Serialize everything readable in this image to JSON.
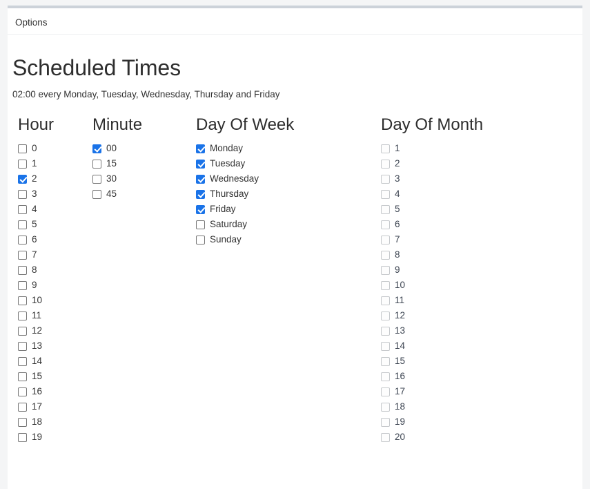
{
  "window": {
    "background_color": "#f4f5f6",
    "panel_color": "#ffffff",
    "accent_color": "#1a73e8",
    "top_border_color": "#ccd2d9"
  },
  "tabs": [
    {
      "id": "options",
      "label": "Options",
      "selected": true
    }
  ],
  "page": {
    "title": "Scheduled Times",
    "subtitle": "02:00 every Monday, Tuesday, Wednesday, Thursday and Friday"
  },
  "columns": [
    {
      "id": "hour",
      "heading": "Hour",
      "disabled": false,
      "options": [
        {
          "label": "0",
          "checked": false
        },
        {
          "label": "1",
          "checked": false
        },
        {
          "label": "2",
          "checked": true
        },
        {
          "label": "3",
          "checked": false
        },
        {
          "label": "4",
          "checked": false
        },
        {
          "label": "5",
          "checked": false
        },
        {
          "label": "6",
          "checked": false
        },
        {
          "label": "7",
          "checked": false
        },
        {
          "label": "8",
          "checked": false
        },
        {
          "label": "9",
          "checked": false
        },
        {
          "label": "10",
          "checked": false
        },
        {
          "label": "11",
          "checked": false
        },
        {
          "label": "12",
          "checked": false
        },
        {
          "label": "13",
          "checked": false
        },
        {
          "label": "14",
          "checked": false
        },
        {
          "label": "15",
          "checked": false
        },
        {
          "label": "16",
          "checked": false
        },
        {
          "label": "17",
          "checked": false
        },
        {
          "label": "18",
          "checked": false
        },
        {
          "label": "19",
          "checked": false
        }
      ]
    },
    {
      "id": "minute",
      "heading": "Minute",
      "disabled": false,
      "options": [
        {
          "label": "00",
          "checked": true
        },
        {
          "label": "15",
          "checked": false
        },
        {
          "label": "30",
          "checked": false
        },
        {
          "label": "45",
          "checked": false
        }
      ]
    },
    {
      "id": "day-of-week",
      "heading": "Day Of Week",
      "disabled": false,
      "options": [
        {
          "label": "Monday",
          "checked": true
        },
        {
          "label": "Tuesday",
          "checked": true
        },
        {
          "label": "Wednesday",
          "checked": true
        },
        {
          "label": "Thursday",
          "checked": true
        },
        {
          "label": "Friday",
          "checked": true
        },
        {
          "label": "Saturday",
          "checked": false
        },
        {
          "label": "Sunday",
          "checked": false
        }
      ]
    },
    {
      "id": "day-of-month",
      "heading": "Day Of Month",
      "disabled": true,
      "options": [
        {
          "label": "1",
          "checked": false
        },
        {
          "label": "2",
          "checked": false
        },
        {
          "label": "3",
          "checked": false
        },
        {
          "label": "4",
          "checked": false
        },
        {
          "label": "5",
          "checked": false
        },
        {
          "label": "6",
          "checked": false
        },
        {
          "label": "7",
          "checked": false
        },
        {
          "label": "8",
          "checked": false
        },
        {
          "label": "9",
          "checked": false
        },
        {
          "label": "10",
          "checked": false
        },
        {
          "label": "11",
          "checked": false
        },
        {
          "label": "12",
          "checked": false
        },
        {
          "label": "13",
          "checked": false
        },
        {
          "label": "14",
          "checked": false
        },
        {
          "label": "15",
          "checked": false
        },
        {
          "label": "16",
          "checked": false
        },
        {
          "label": "17",
          "checked": false
        },
        {
          "label": "18",
          "checked": false
        },
        {
          "label": "19",
          "checked": false
        },
        {
          "label": "20",
          "checked": false
        }
      ]
    }
  ]
}
